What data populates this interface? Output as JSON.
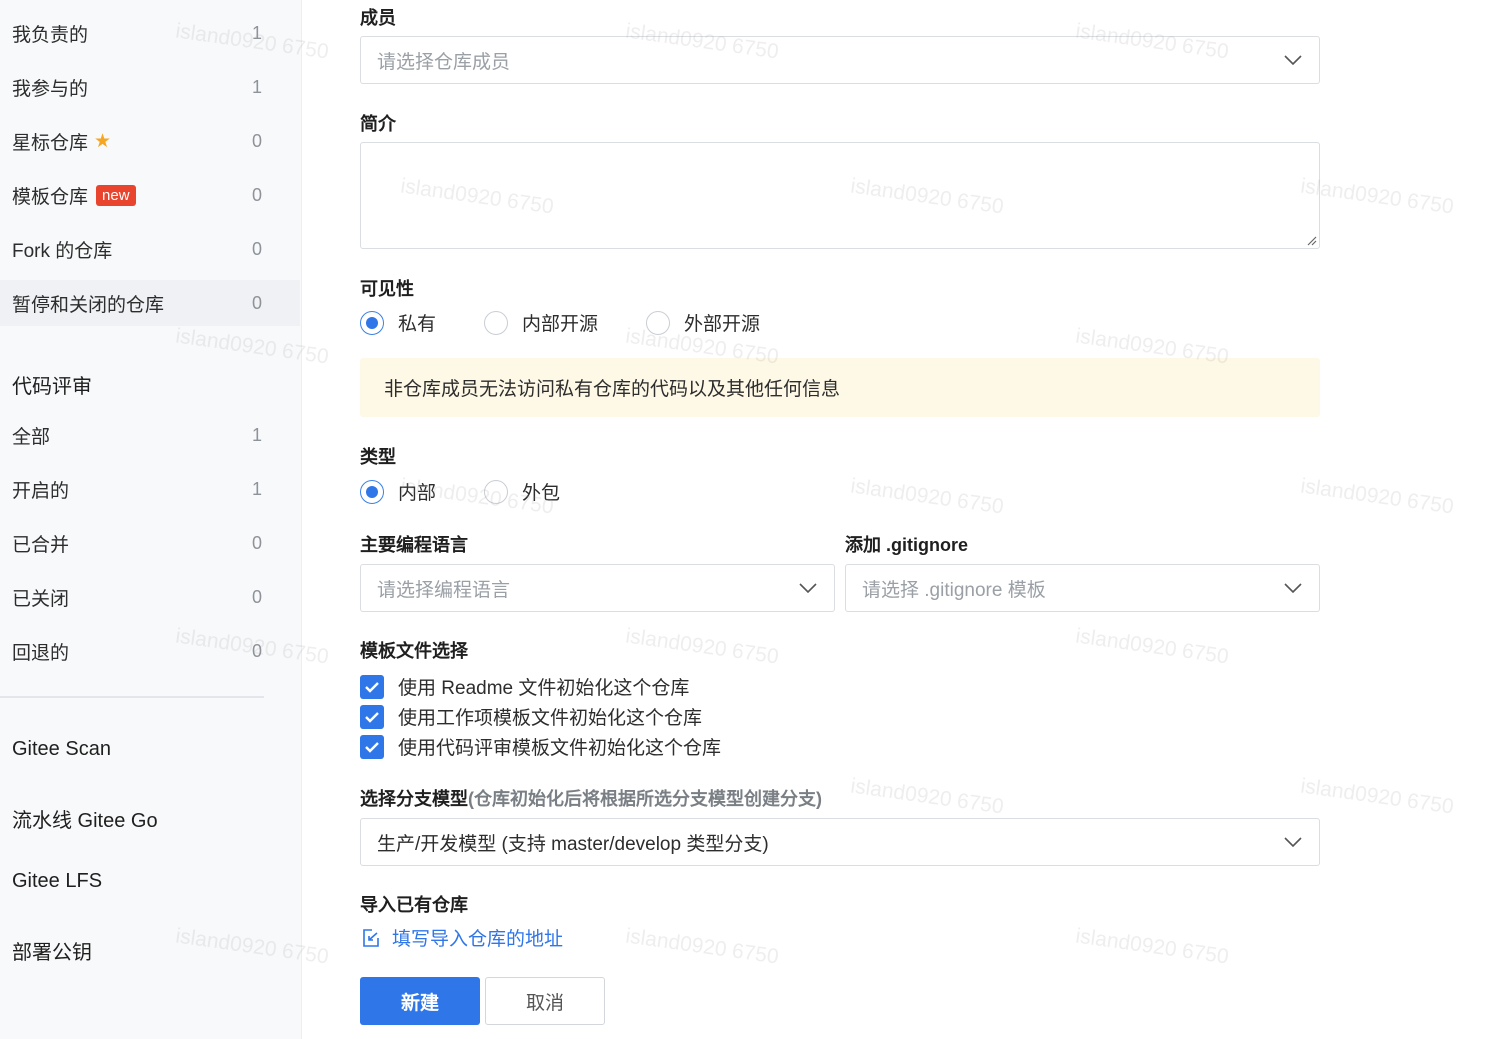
{
  "sidebar": {
    "repos": [
      {
        "label": "我负责的",
        "count": "1"
      },
      {
        "label": "我参与的",
        "count": "1"
      },
      {
        "label": "星标仓库",
        "count": "0"
      },
      {
        "label": "模板仓库",
        "count": "0",
        "badge": "new"
      },
      {
        "label": "Fork 的仓库",
        "count": "0"
      },
      {
        "label": "暂停和关闭的仓库",
        "count": "0"
      }
    ],
    "review_heading": "代码评审",
    "reviews": [
      {
        "label": "全部",
        "count": "1"
      },
      {
        "label": "开启的",
        "count": "1"
      },
      {
        "label": "已合并",
        "count": "0"
      },
      {
        "label": "已关闭",
        "count": "0"
      },
      {
        "label": "回退的",
        "count": "0"
      }
    ],
    "links": [
      "Gitee Scan",
      "流水线 Gitee Go",
      "Gitee LFS",
      "部署公钥"
    ]
  },
  "form": {
    "members_label": "成员",
    "members_placeholder": "请选择仓库成员",
    "intro_label": "简介",
    "visibility_label": "可见性",
    "visibility_options": [
      "私有",
      "内部开源",
      "外部开源"
    ],
    "visibility_notice": "非仓库成员无法访问私有仓库的代码以及其他任何信息",
    "type_label": "类型",
    "type_options": [
      "内部",
      "外包"
    ],
    "language_label": "主要编程语言",
    "language_placeholder": "请选择编程语言",
    "gitignore_label": "添加 .gitignore",
    "gitignore_placeholder": "请选择 .gitignore 模板",
    "template_label": "模板文件选择",
    "template_options": [
      "使用 Readme 文件初始化这个仓库",
      "使用工作项模板文件初始化这个仓库",
      "使用代码评审模板文件初始化这个仓库"
    ],
    "branch_label": "选择分支模型",
    "branch_hint": "(仓库初始化后将根据所选分支模型创建分支)",
    "branch_value": "生产/开发模型 (支持 master/develop 类型分支)",
    "import_label": "导入已有仓库",
    "import_link": "填写导入仓库的地址",
    "submit_label": "新建",
    "cancel_label": "取消"
  },
  "watermark": "island0920 6750",
  "colors": {
    "accent": "#2f76e8",
    "notice_bg": "#fef8e6",
    "badge": "#e8442e",
    "star": "#f5a623"
  }
}
